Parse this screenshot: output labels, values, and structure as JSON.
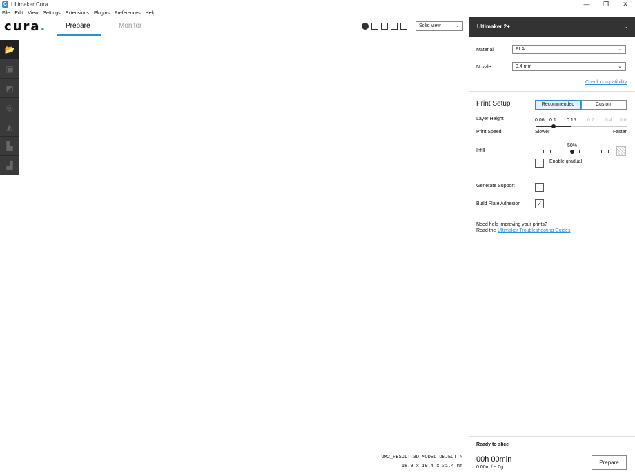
{
  "window": {
    "title": "Ultimaker Cura",
    "controls": [
      "—",
      "❐",
      "✕"
    ]
  },
  "menu": [
    "File",
    "Edit",
    "View",
    "Settings",
    "Extensions",
    "Plugins",
    "Preferences",
    "Help"
  ],
  "header": {
    "logo": "cura",
    "tabs": [
      {
        "label": "Prepare",
        "active": true
      },
      {
        "label": "Monitor",
        "active": false
      }
    ],
    "view_mode": "Solid view"
  },
  "object": {
    "name": "UM2_RESULT 3D MODEL OBJECT",
    "dimensions": "18.9 x 19.4 x 31.4 mm"
  },
  "sidebar": {
    "machine": "Ultimaker 2+",
    "material_label": "Material",
    "material_value": "PLA",
    "nozzle_label": "Nozzle",
    "nozzle_value": "0.4 mm",
    "compat_link": "Check compatibility",
    "print_setup": "Print Setup",
    "mode_recommended": "Recommended",
    "mode_custom": "Custom",
    "layer_height_label": "Layer Height",
    "layer_values": [
      "0.06",
      "0.1",
      "0.15",
      "0.2",
      "0.4",
      "0.6"
    ],
    "print_speed_label": "Print Speed",
    "slower": "Slower",
    "faster": "Faster",
    "infill_label": "Infill",
    "infill_value": "50%",
    "gradual_label": "Enable gradual",
    "support_label": "Generate Support",
    "adhesion_label": "Build Plate Adhesion",
    "help_line1": "Need help improving your prints?",
    "help_line2_prefix": "Read the",
    "help_link": "Ultimaker Troubleshooting Guides"
  },
  "footer": {
    "status": "Ready to slice",
    "time": "00h 00min",
    "usage": "0.00m / ~ 0g",
    "prepare_button": "Prepare"
  },
  "colors": {
    "accent": "#2d8fd5",
    "model": "#f2d86a",
    "overhang": "#ee1111"
  },
  "settings": {
    "layer_height_selected": "0.1",
    "infill_percent": 50,
    "generate_support": false,
    "build_plate_adhesion": true,
    "enable_gradual": false
  }
}
